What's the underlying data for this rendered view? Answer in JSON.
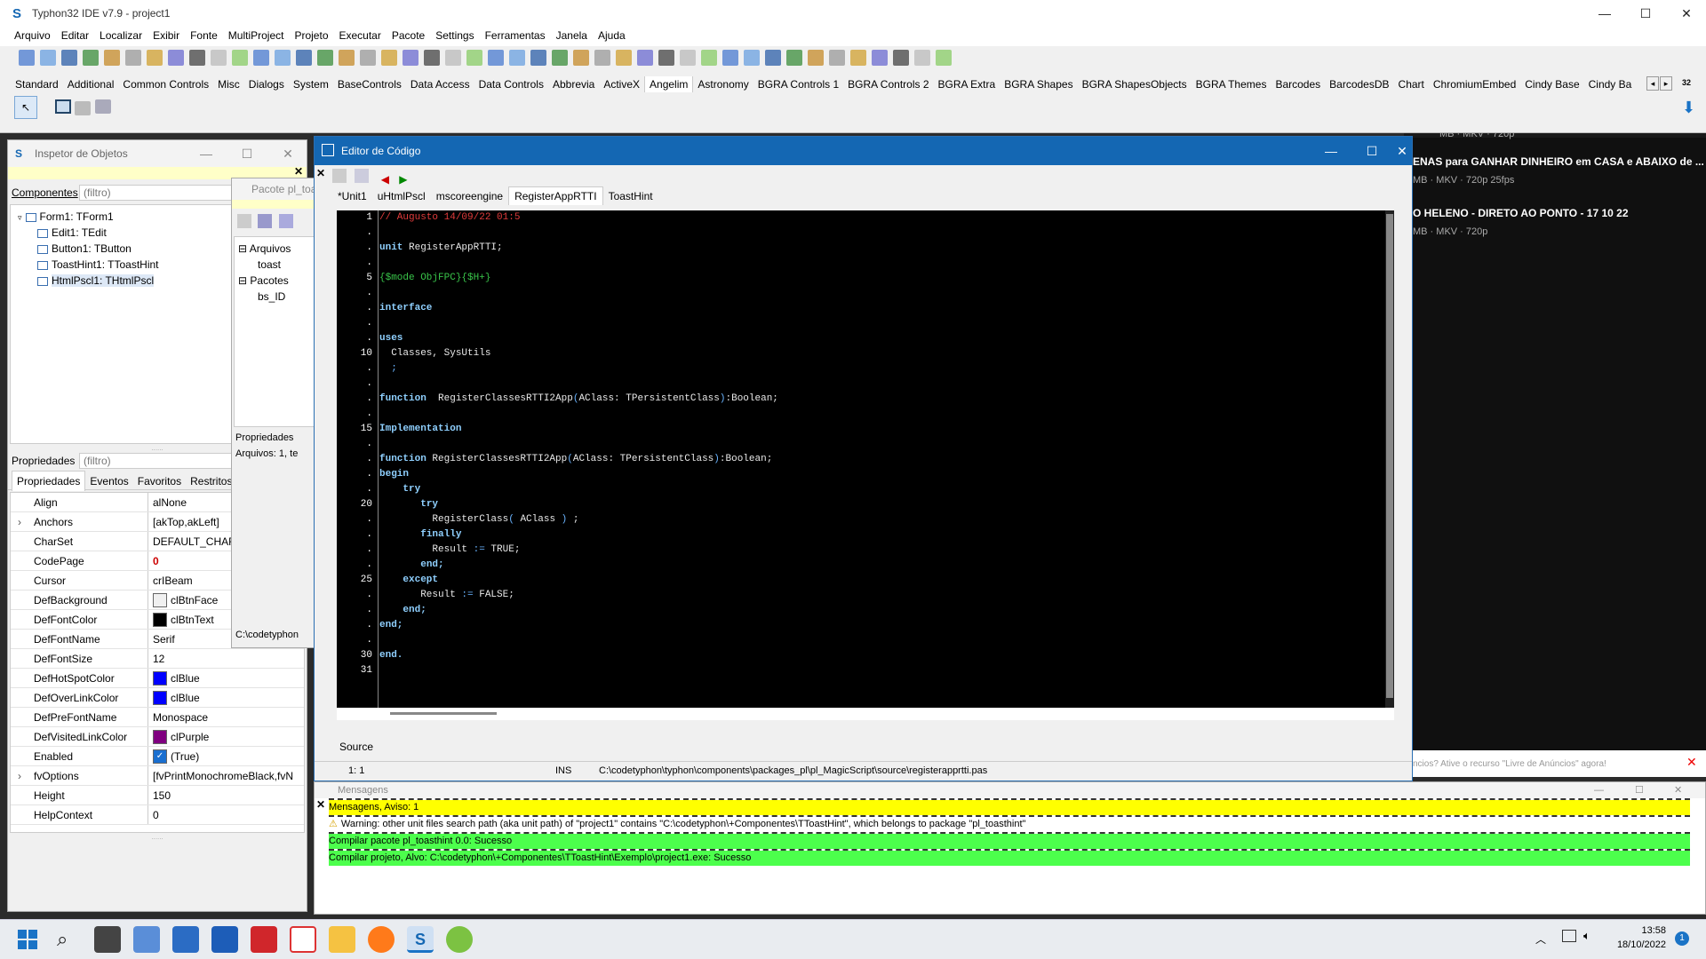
{
  "ide": {
    "title": "Typhon32 IDE v7.9 - project1",
    "menu": [
      "Arquivo",
      "Editar",
      "Localizar",
      "Exibir",
      "Fonte",
      "MultiProject",
      "Projeto",
      "Executar",
      "Pacote",
      "Settings",
      "Ferramentas",
      "Janela",
      "Ajuda"
    ],
    "palette_tabs": [
      "Standard",
      "Additional",
      "Common Controls",
      "Misc",
      "Dialogs",
      "System",
      "BaseControls",
      "Data Access",
      "Data Controls",
      "Abbrevia",
      "ActiveX",
      "Angelim",
      "Astronomy",
      "BGRA Controls 1",
      "BGRA Controls 2",
      "BGRA Extra",
      "BGRA Shapes",
      "BGRA ShapesObjects",
      "BGRA Themes",
      "Barcodes",
      "BarcodesDB",
      "Chart",
      "ChromiumEmbed",
      "Cindy Base",
      "Cindy Ba"
    ],
    "active_palette_tab": "Angelim",
    "palette_counter": "32"
  },
  "bgpage": {
    "items": [
      {
        "title": "ENAS para GANHAR DINHEIRO em CASA e ABAIXO de ...",
        "meta": "MB · MKV · 720p 25fps"
      },
      {
        "title": "O HELENO - DIRETO AO PONTO - 17 10 22",
        "meta": "MB · MKV · 720p"
      }
    ],
    "top_meta": "MB · MKV · 720p",
    "ad_text": "ncios? Ative o recurso \"Livre de Anúncios\" agora!"
  },
  "inspector": {
    "title": "Inspetor de Objetos",
    "components_label": "Componentes",
    "components_filter": "(filtro)",
    "tree": [
      {
        "label": "Form1: TForm1",
        "level": 0
      },
      {
        "label": "Edit1: TEdit",
        "level": 1
      },
      {
        "label": "Button1: TButton",
        "level": 1
      },
      {
        "label": "ToastHint1: TToastHint",
        "level": 1
      },
      {
        "label": "HtmlPscl1: THtmlPscl",
        "level": 1
      }
    ],
    "props_label": "Propriedades",
    "props_filter": "(filtro)",
    "tabs": [
      "Propriedades",
      "Eventos",
      "Favoritos",
      "Restritos"
    ],
    "props": [
      {
        "name": "Align",
        "value": "alNone"
      },
      {
        "name": "Anchors",
        "value": "[akTop,akLeft]",
        "expand": true
      },
      {
        "name": "CharSet",
        "value": "DEFAULT_CHARSET"
      },
      {
        "name": "CodePage",
        "value": "0",
        "bold": true
      },
      {
        "name": "Cursor",
        "value": "crIBeam"
      },
      {
        "name": "DefBackground",
        "value": "clBtnFace",
        "color": "#f0f0f0"
      },
      {
        "name": "DefFontColor",
        "value": "clBtnText",
        "color": "#000000"
      },
      {
        "name": "DefFontName",
        "value": "Serif"
      },
      {
        "name": "DefFontSize",
        "value": "12"
      },
      {
        "name": "DefHotSpotColor",
        "value": "clBlue",
        "color": "#0000ff"
      },
      {
        "name": "DefOverLinkColor",
        "value": "clBlue",
        "color": "#0000ff"
      },
      {
        "name": "DefPreFontName",
        "value": "Monospace"
      },
      {
        "name": "DefVisitedLinkColor",
        "value": "clPurple",
        "color": "#800080"
      },
      {
        "name": "Enabled",
        "value": "(True)",
        "check": true
      },
      {
        "name": "fvOptions",
        "value": "[fvPrintMonochromeBlack,fvN",
        "expand": true
      },
      {
        "name": "Height",
        "value": "150"
      },
      {
        "name": "HelpContext",
        "value": "0"
      }
    ]
  },
  "package": {
    "title": "Pacote pl_toa",
    "tree": [
      "Arquivos",
      "toast",
      "Pacotes",
      "bs_ID"
    ],
    "props_tab": "Propriedades",
    "files_info": "Arquivos: 1, te",
    "path": "C:\\codetyphon"
  },
  "editor": {
    "title": "Editor de Código",
    "tabs": [
      "*Unit1",
      "uHtmlPscl",
      "mscoreengine",
      "RegisterAppRTTI",
      "ToastHint"
    ],
    "active_tab": "RegisterAppRTTI",
    "source_tab": "Source",
    "status_pos": "1:  1",
    "status_mode": "INS",
    "status_path": "C:\\codetyphon\\typhon\\components\\packages_pl\\pl_MagicScript\\source\\registerapprtti.pas",
    "gutter": [
      "1",
      ".",
      ".",
      ".",
      "5",
      ".",
      ".",
      ".",
      ".",
      "10",
      ".",
      ".",
      ".",
      ".",
      "15",
      ".",
      ".",
      ".",
      ".",
      "20",
      ".",
      ".",
      ".",
      ".",
      "25",
      ".",
      ".",
      ".",
      ".",
      "30",
      "31"
    ],
    "lines": [
      [
        {
          "t": "// Augusto 14/09/22 01:5",
          "c": "cm"
        }
      ],
      [],
      [
        {
          "t": "unit",
          "c": "kw"
        },
        {
          "t": " RegisterAppRTTI;"
        }
      ],
      [],
      [
        {
          "t": "{$mode ObjFPC}{$H+}",
          "c": "dr"
        }
      ],
      [],
      [
        {
          "t": "interface",
          "c": "kw"
        }
      ],
      [],
      [
        {
          "t": "uses",
          "c": "kw"
        }
      ],
      [
        {
          "t": "  Classes, SysUtils"
        }
      ],
      [
        {
          "t": "  ;",
          "c": "sym"
        }
      ],
      [],
      [
        {
          "t": "function",
          "c": "kw"
        },
        {
          "t": "  RegisterClassesRTTI2App"
        },
        {
          "t": "(",
          "c": "sym"
        },
        {
          "t": "AClass: TPersistentClass"
        },
        {
          "t": ")",
          "c": "sym"
        },
        {
          "t": ":Boolean;"
        }
      ],
      [],
      [
        {
          "t": "Implementation",
          "c": "kw"
        }
      ],
      [],
      [
        {
          "t": "function",
          "c": "kw"
        },
        {
          "t": " RegisterClassesRTTI2App"
        },
        {
          "t": "(",
          "c": "sym"
        },
        {
          "t": "AClass: TPersistentClass"
        },
        {
          "t": ")",
          "c": "sym"
        },
        {
          "t": ":Boolean;"
        }
      ],
      [
        {
          "t": "begin",
          "c": "kw"
        }
      ],
      [
        {
          "t": "    "
        },
        {
          "t": "try",
          "c": "kw"
        }
      ],
      [
        {
          "t": "       "
        },
        {
          "t": "try",
          "c": "kw"
        }
      ],
      [
        {
          "t": "         RegisterClass"
        },
        {
          "t": "(",
          "c": "sym"
        },
        {
          "t": " AClass "
        },
        {
          "t": ")",
          "c": "sym"
        },
        {
          "t": " ;"
        }
      ],
      [
        {
          "t": "       "
        },
        {
          "t": "finally",
          "c": "kw"
        }
      ],
      [
        {
          "t": "         Result "
        },
        {
          "t": ":=",
          "c": "sym"
        },
        {
          "t": " TRUE;"
        }
      ],
      [
        {
          "t": "       "
        },
        {
          "t": "end;",
          "c": "kw"
        }
      ],
      [
        {
          "t": "    "
        },
        {
          "t": "except",
          "c": "kw"
        }
      ],
      [
        {
          "t": "       Result "
        },
        {
          "t": ":=",
          "c": "sym"
        },
        {
          "t": " FALSE;"
        }
      ],
      [
        {
          "t": "    "
        },
        {
          "t": "end;",
          "c": "kw"
        }
      ],
      [
        {
          "t": "end;",
          "c": "kw"
        }
      ],
      [],
      [
        {
          "t": "end.",
          "c": "kw"
        }
      ],
      []
    ]
  },
  "messages": {
    "title": "Mensagens",
    "rows": [
      {
        "text": "Mensagens, Aviso: 1",
        "bg": "#ffff00"
      },
      {
        "text": "Warning: other unit files search path (aka unit path) of \"project1\" contains \"C:\\codetyphon\\+Componentes\\TToastHint\", which belongs to package \"pl_toasthint\"",
        "bg": "#ffffff",
        "warn": true
      },
      {
        "text": "Compilar pacote pl_toasthint 0.0: Sucesso",
        "bg": "#4cff4c"
      },
      {
        "text": "Compilar projeto, Alvo: C:\\codetyphon\\+Componentes\\TToastHint\\Exemplo\\project1.exe: Sucesso",
        "bg": "#4cff4c"
      }
    ]
  },
  "taskbar": {
    "time": "13:58",
    "date": "18/10/2022",
    "badge": "1"
  }
}
